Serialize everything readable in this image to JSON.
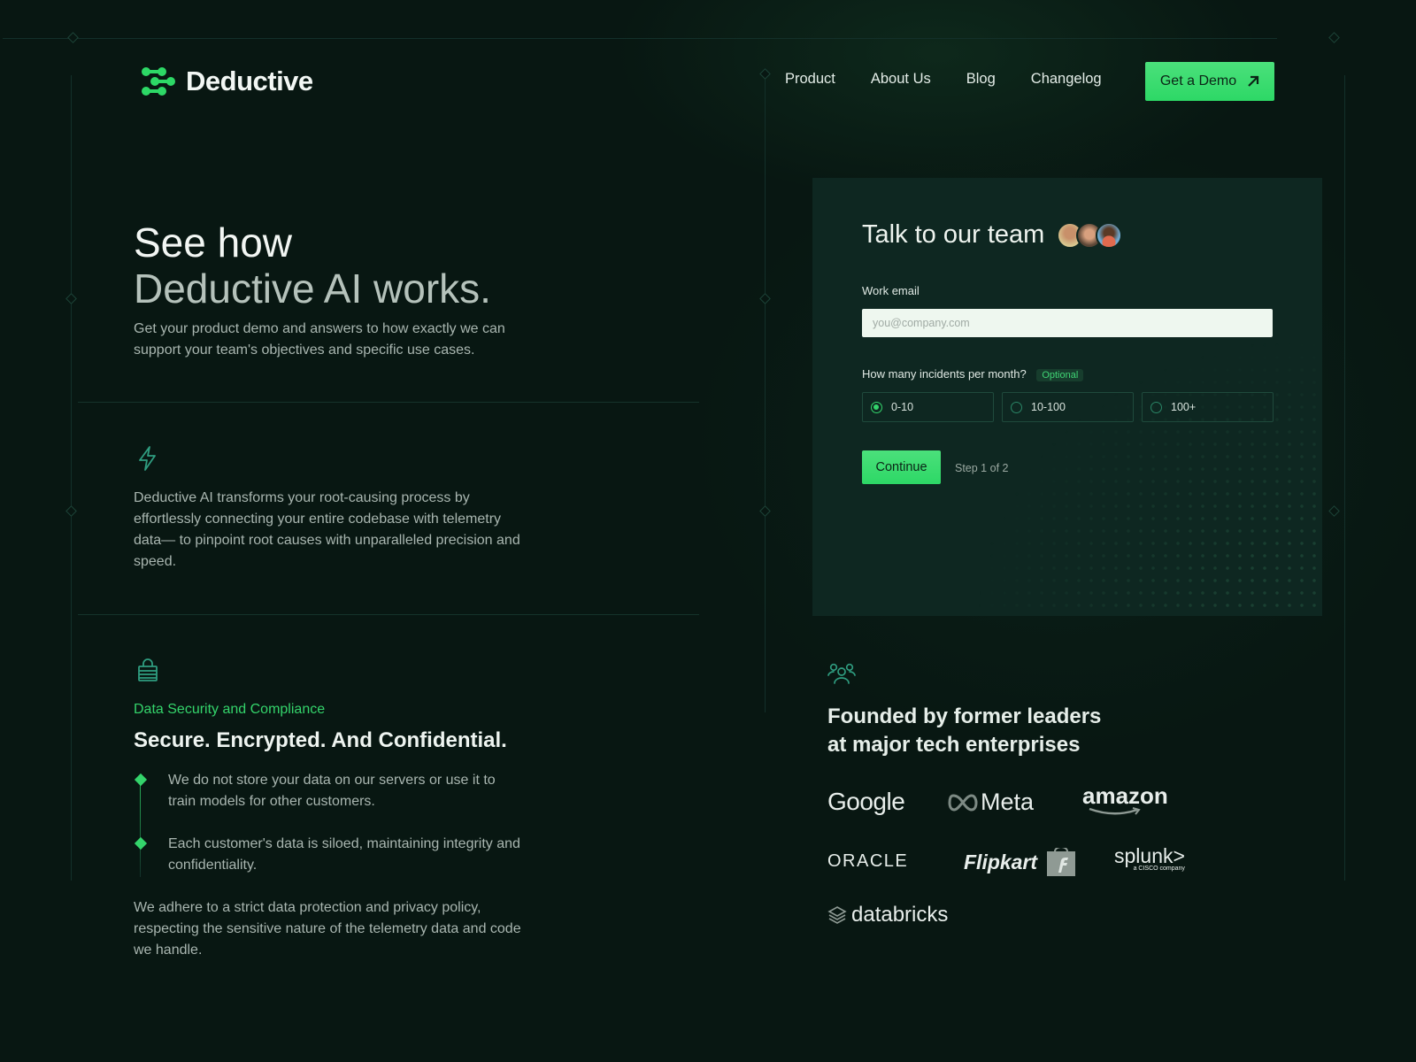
{
  "brand": {
    "name": "Deductive",
    "accent": "#2dd866",
    "icon_accent": "#2f9d80"
  },
  "nav": {
    "items": [
      {
        "label": "Product"
      },
      {
        "label": "About Us"
      },
      {
        "label": "Blog"
      },
      {
        "label": "Changelog"
      }
    ],
    "cta_label": "Get a Demo",
    "cta_icon": "arrow-up-right-icon"
  },
  "hero": {
    "title_line1": "See how",
    "title_line2": "Deductive AI works.",
    "subtitle": "Get your product demo and answers to how exactly we can support your team's objectives and specific use cases."
  },
  "feature": {
    "icon": "lightning-icon",
    "text": "Deductive AI transforms your root-causing process by effortlessly connecting your entire codebase with telemetry data— to pinpoint root causes with unparalleled precision and speed."
  },
  "security": {
    "icon": "lock-icon",
    "eyebrow": "Data Security and Compliance",
    "title": "Secure. Encrypted. And Confidential.",
    "bullets": [
      "We do not store your data on our servers or use it to train models for other customers.",
      "Each customer's data is siloed, maintaining integrity and confidentiality."
    ],
    "closing": "We adhere to a strict data protection and privacy policy, respecting the sensitive nature of the telemetry data and code we handle."
  },
  "form": {
    "title": "Talk to our team",
    "avatar_count": 3,
    "email_label": "Work email",
    "email_value": "",
    "email_placeholder": "you@company.com",
    "incidents_label": "How many incidents per month?",
    "optional_badge": "Optional",
    "options": [
      {
        "label": "0-10",
        "checked": true
      },
      {
        "label": "10-100",
        "checked": false
      },
      {
        "label": "100+",
        "checked": false
      }
    ],
    "continue_label": "Continue",
    "step_text": "Step 1 of 2"
  },
  "founders": {
    "icon": "users-icon",
    "title": "Founded by former leaders at major tech enterprises",
    "logos": {
      "google": "Google",
      "meta": "Meta",
      "amazon": "amazon",
      "oracle": "ORACLE",
      "flipkart": "Flipkart",
      "splunk": "splunk>",
      "splunk_sub": "a CISCO company",
      "databricks": "databricks"
    }
  }
}
